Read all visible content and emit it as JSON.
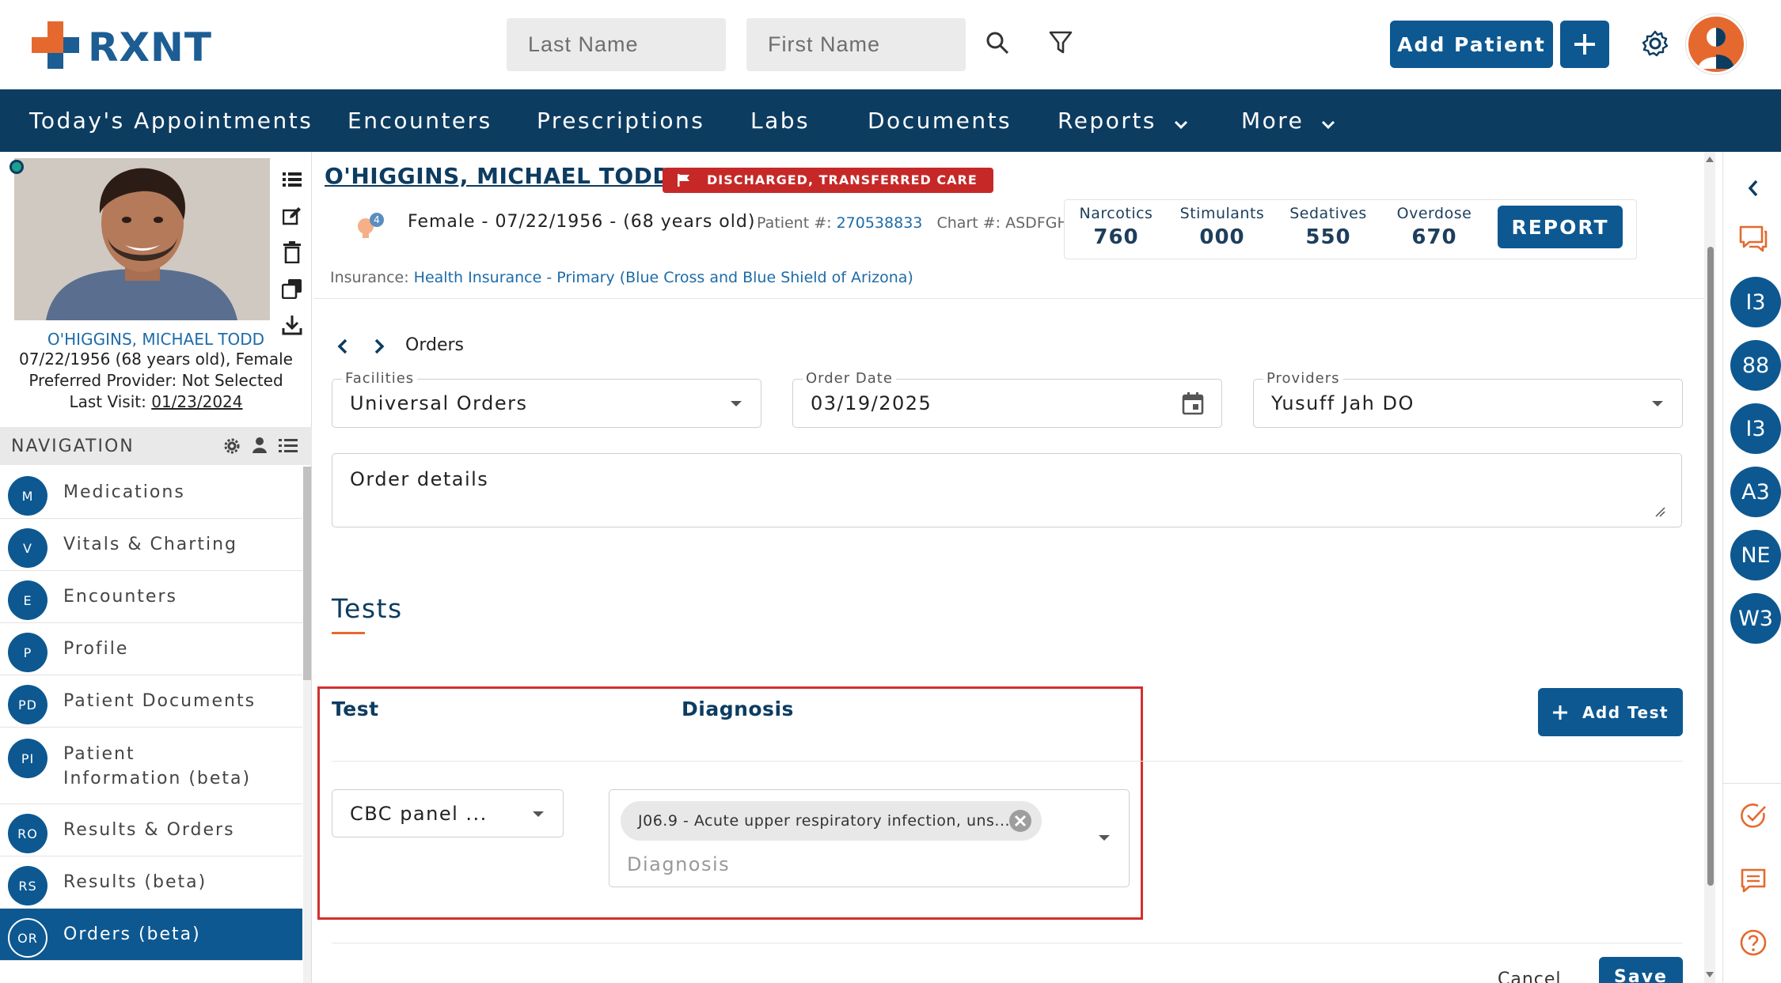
{
  "header": {
    "logo_text": "RXNT",
    "last_name_placeholder": "Last Name",
    "first_name_placeholder": "First Name",
    "add_patient_label": "Add Patient"
  },
  "nav": {
    "items": [
      {
        "label": "Today's Appointments"
      },
      {
        "label": "Encounters"
      },
      {
        "label": "Prescriptions"
      },
      {
        "label": "Labs"
      },
      {
        "label": "Documents"
      },
      {
        "label": "Reports"
      },
      {
        "label": "More"
      }
    ]
  },
  "patient_card": {
    "name": "O'HIGGINS, MICHAEL TODD",
    "dob_line": "07/22/1956 (68 years old), Female",
    "provider_line": "Preferred Provider: Not Selected",
    "last_visit_label": "Last Visit:",
    "last_visit_value": "01/23/2024"
  },
  "navigation": {
    "title": "NAVIGATION",
    "items": [
      {
        "badge": "M",
        "label": "Medications"
      },
      {
        "badge": "V",
        "label": "Vitals & Charting"
      },
      {
        "badge": "E",
        "label": "Encounters"
      },
      {
        "badge": "P",
        "label": "Profile"
      },
      {
        "badge": "PD",
        "label": "Patient Documents"
      },
      {
        "badge": "PI",
        "label": "Patient Information (beta)"
      },
      {
        "badge": "RO",
        "label": "Results & Orders"
      },
      {
        "badge": "RS",
        "label": "Results (beta)"
      },
      {
        "badge": "OR",
        "label": "Orders (beta)"
      }
    ]
  },
  "patient": {
    "title": "O'HIGGINS, MICHAEL TODD",
    "status": "DISCHARGED, TRANSFERRED CARE",
    "alert_count": "4",
    "demographics": "Female - 07/22/1956 - (68 years old)",
    "patient_num_label": "Patient #:",
    "patient_num": "270538833",
    "chart_label": "Chart #:",
    "chart_value": "ASDFGH",
    "insurance_label": "Insurance:",
    "insurance_value": "Health Insurance - Primary (Blue Cross and Blue Shield of Arizona)"
  },
  "counts": [
    {
      "label": "Narcotics",
      "value": "760"
    },
    {
      "label": "Stimulants",
      "value": "000"
    },
    {
      "label": "Sedatives",
      "value": "550"
    },
    {
      "label": "Overdose",
      "value": "670"
    }
  ],
  "report_label": "REPORT",
  "orders": {
    "breadcrumb": "Orders",
    "facilities_label": "Facilities",
    "facilities_value": "Universal Orders",
    "order_date_label": "Order Date",
    "order_date_value": "03/19/2025",
    "providers_label": "Providers",
    "providers_value": "Yusuff Jah DO",
    "details_placeholder": "Order details",
    "tests_title": "Tests",
    "col_test": "Test",
    "col_diagnosis": "Diagnosis",
    "add_test_label": "Add Test",
    "test_value": "CBC panel ...",
    "diagnosis_chip": "J06.9 - Acute upper respiratory infection, uns...",
    "diagnosis_placeholder": "Diagnosis",
    "cancel_label": "Cancel",
    "save_label": "Save"
  },
  "rail": {
    "circles": [
      "I3",
      "88",
      "I3",
      "A3",
      "NE",
      "W3"
    ]
  },
  "colors": {
    "brand_blue": "#0d5891",
    "nav_dark": "#0d3c61",
    "accent_orange": "#e5692e",
    "status_red": "#c62828"
  }
}
